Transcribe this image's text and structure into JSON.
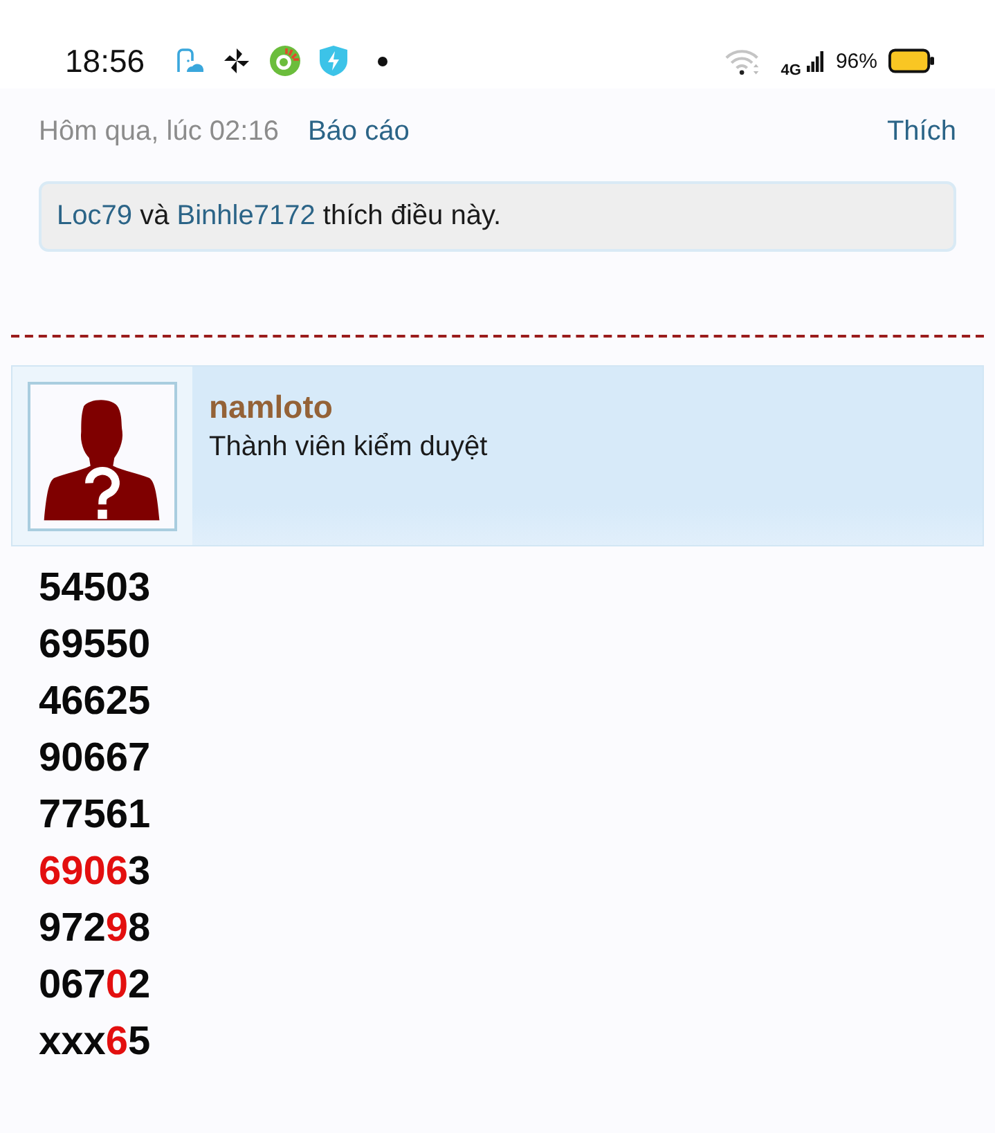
{
  "status_bar": {
    "time": "18:56",
    "network": "4G",
    "battery": "96%"
  },
  "post_footer": {
    "date": "Hôm qua, lúc 02:16",
    "report_link": "Báo cáo",
    "like_link": "Thích"
  },
  "likes": {
    "parts": [
      {
        "kind": "link",
        "text": "Loc79"
      },
      {
        "kind": "text",
        "text": "và"
      },
      {
        "kind": "link",
        "text": "Binhle7172"
      },
      {
        "kind": "text",
        "text": "thích điều này."
      }
    ]
  },
  "author": {
    "username": "namloto",
    "role": "Thành viên kiểm duyệt"
  },
  "post": {
    "lines": [
      {
        "segments": [
          {
            "text": "54503",
            "highlight": false
          }
        ]
      },
      {
        "segments": [
          {
            "text": "69550",
            "highlight": false
          }
        ]
      },
      {
        "segments": [
          {
            "text": "46625",
            "highlight": false
          }
        ]
      },
      {
        "segments": [
          {
            "text": "90667",
            "highlight": false
          }
        ]
      },
      {
        "segments": [
          {
            "text": "77561",
            "highlight": false
          }
        ]
      },
      {
        "segments": [
          {
            "text": "6906",
            "highlight": true
          },
          {
            "text": "3",
            "highlight": false
          }
        ]
      },
      {
        "segments": [
          {
            "text": "972",
            "highlight": false
          },
          {
            "text": "9",
            "highlight": true
          },
          {
            "text": "8",
            "highlight": false
          }
        ]
      },
      {
        "segments": [
          {
            "text": "067",
            "highlight": false
          },
          {
            "text": "0",
            "highlight": true
          },
          {
            "text": "2",
            "highlight": false
          }
        ]
      },
      {
        "segments": [
          {
            "text": "xxx",
            "highlight": false
          },
          {
            "text": "6",
            "highlight": true
          },
          {
            "text": "5",
            "highlight": false
          }
        ]
      }
    ]
  }
}
